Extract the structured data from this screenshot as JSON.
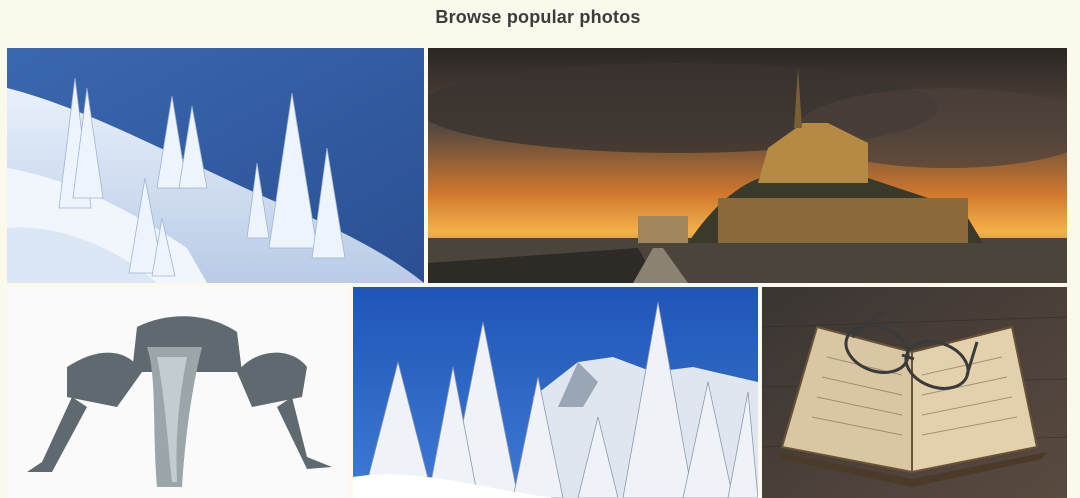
{
  "gallery": {
    "heading": "Browse popular photos",
    "photos": [
      {
        "subject": "snowy-mountain-slope-with-pines"
      },
      {
        "subject": "castle-on-island-at-sunset"
      },
      {
        "subject": "yoga-pose-black-and-white"
      },
      {
        "subject": "snow-covered-fir-trees-and-peak"
      },
      {
        "subject": "open-book-with-eyeglasses"
      }
    ]
  }
}
